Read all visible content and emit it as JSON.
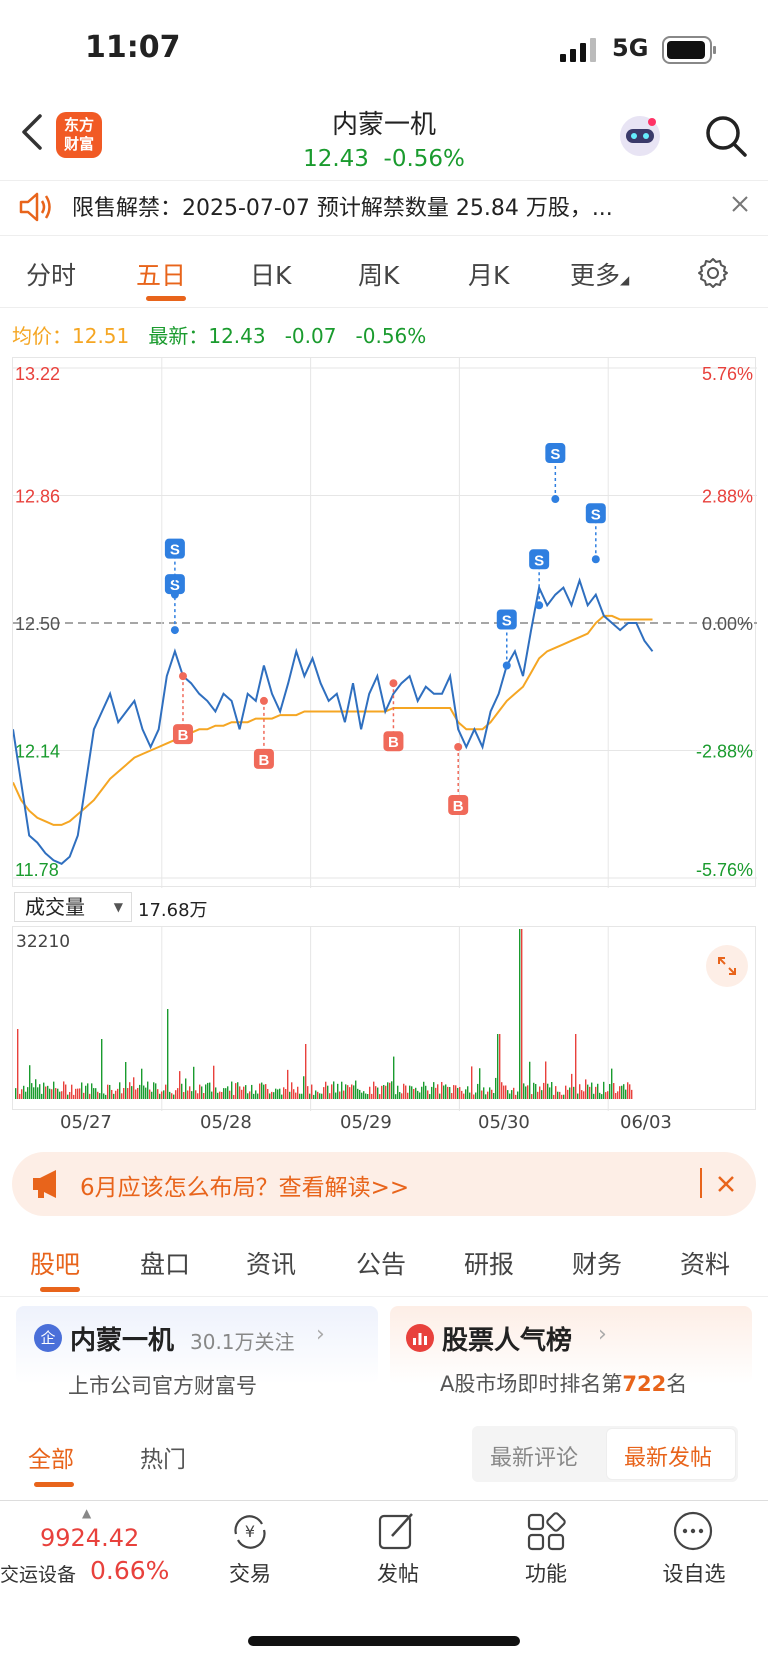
{
  "status": {
    "time": "11:07",
    "network": "5G"
  },
  "header": {
    "logo_line1": "东方",
    "logo_line2": "财富",
    "title": "内蒙一机",
    "price": "12.43",
    "change_pct": "-0.56%"
  },
  "notice": {
    "text": "限售解禁：2025-07-07 预计解禁数量 25.84 万股，..."
  },
  "tabs": [
    "分时",
    "五日",
    "日K",
    "周K",
    "月K",
    "更多"
  ],
  "active_tab": "五日",
  "info": {
    "avg_label": "均价：",
    "avg_value": "12.51",
    "latest_label": "最新：",
    "latest_value": "12.43",
    "change": "-0.07",
    "change_pct": "-0.56%"
  },
  "colors": {
    "up": "#e8413c",
    "down": "#1a9b2e",
    "accent": "#e8641b",
    "avg_line": "#f5a623",
    "price_line": "#2f6fbf"
  },
  "chart_data": {
    "type": "line",
    "title": "",
    "x_labels": [
      "05/27",
      "05/28",
      "05/29",
      "05/30",
      "06/03"
    ],
    "y_left_ticks": [
      "13.22",
      "12.86",
      "12.50",
      "12.14",
      "11.78"
    ],
    "y_right_ticks": [
      "5.76%",
      "2.88%",
      "0.00%",
      "-2.88%",
      "-5.76%"
    ],
    "ylim": [
      11.78,
      13.22
    ],
    "prev_close": 12.5,
    "series": [
      {
        "values": [
          12.2,
          12.05,
          11.9,
          11.88,
          11.85,
          11.83,
          11.82,
          11.84,
          11.9,
          12.05,
          12.2,
          12.25,
          12.3,
          12.22,
          12.25,
          12.28,
          12.2,
          12.15,
          12.2,
          12.35,
          12.42,
          12.35,
          12.33,
          12.3,
          12.28,
          12.25,
          12.3,
          12.28,
          12.2,
          12.3,
          12.28,
          12.38,
          12.3,
          12.25,
          12.33,
          12.42,
          12.35,
          12.4,
          12.33,
          12.28,
          12.3,
          12.22,
          12.33,
          12.2,
          12.3,
          12.35,
          12.25,
          12.3,
          12.33,
          12.35,
          12.28,
          12.32,
          12.3,
          12.3,
          12.35,
          12.2,
          12.15,
          12.2,
          12.15,
          12.25,
          12.3,
          12.38,
          12.42,
          12.35,
          12.48,
          12.6,
          12.55,
          12.58,
          12.6,
          12.55,
          12.62,
          12.55,
          12.58,
          12.52,
          12.5,
          12.48,
          12.5,
          12.5,
          12.45,
          12.42
        ]
      },
      {
        "values": [
          12.05,
          12.0,
          11.97,
          11.95,
          11.94,
          11.93,
          11.93,
          11.94,
          11.96,
          11.98,
          12.0,
          12.03,
          12.06,
          12.08,
          12.1,
          12.12,
          12.13,
          12.14,
          12.15,
          12.16,
          12.17,
          12.18,
          12.19,
          12.2,
          12.2,
          12.21,
          12.21,
          12.22,
          12.22,
          12.22,
          12.23,
          12.23,
          12.23,
          12.24,
          12.24,
          12.24,
          12.25,
          12.25,
          12.25,
          12.25,
          12.25,
          12.25,
          12.25,
          12.25,
          12.25,
          12.25,
          12.25,
          12.26,
          12.26,
          12.26,
          12.26,
          12.26,
          12.26,
          12.26,
          12.26,
          12.22,
          12.2,
          12.2,
          12.2,
          12.22,
          12.25,
          12.28,
          12.3,
          12.32,
          12.36,
          12.4,
          12.42,
          12.43,
          12.44,
          12.45,
          12.46,
          12.47,
          12.5,
          12.52,
          12.52,
          12.51,
          12.51,
          12.51,
          12.51,
          12.51
        ]
      }
    ],
    "markers": [
      {
        "label": "S",
        "index": 20,
        "price": 12.48
      },
      {
        "label": "S",
        "index": 20,
        "price": 12.58
      },
      {
        "label": "B",
        "index": 21,
        "price": 12.35
      },
      {
        "label": "B",
        "index": 31,
        "price": 12.28
      },
      {
        "label": "B",
        "index": 47,
        "price": 12.33
      },
      {
        "label": "B",
        "index": 55,
        "price": 12.15
      },
      {
        "label": "S",
        "index": 61,
        "price": 12.38
      },
      {
        "label": "S",
        "index": 65,
        "price": 12.55
      },
      {
        "label": "S",
        "index": 67,
        "price": 12.85
      },
      {
        "label": "S",
        "index": 72,
        "price": 12.68
      }
    ],
    "volume": {
      "label": "成交量",
      "value": "17.68万",
      "max_tick": "32210"
    }
  },
  "promo": {
    "text": "6月应该怎么布局？查看解读>>"
  },
  "section_tabs": [
    "股吧",
    "盘口",
    "资讯",
    "公告",
    "研报",
    "财务",
    "资料"
  ],
  "cards": [
    {
      "title": "内蒙一机",
      "badge": "企",
      "followers": "30.1万关注",
      "subtitle": "上市公司官方财富号"
    },
    {
      "title": "股票人气榜",
      "subtitle_prefix": "A股市场即时排名第",
      "rank": "722",
      "subtitle_suffix": "名"
    }
  ],
  "feed_tabs": {
    "all": "全部",
    "hot": "热门",
    "sort1": "最新评论",
    "sort2": "最新发帖"
  },
  "tabbar": {
    "index_value": "9924.42",
    "index_name": "交运设备",
    "index_pct": "0.66%",
    "items": [
      "交易",
      "发帖",
      "功能",
      "设自选"
    ]
  }
}
